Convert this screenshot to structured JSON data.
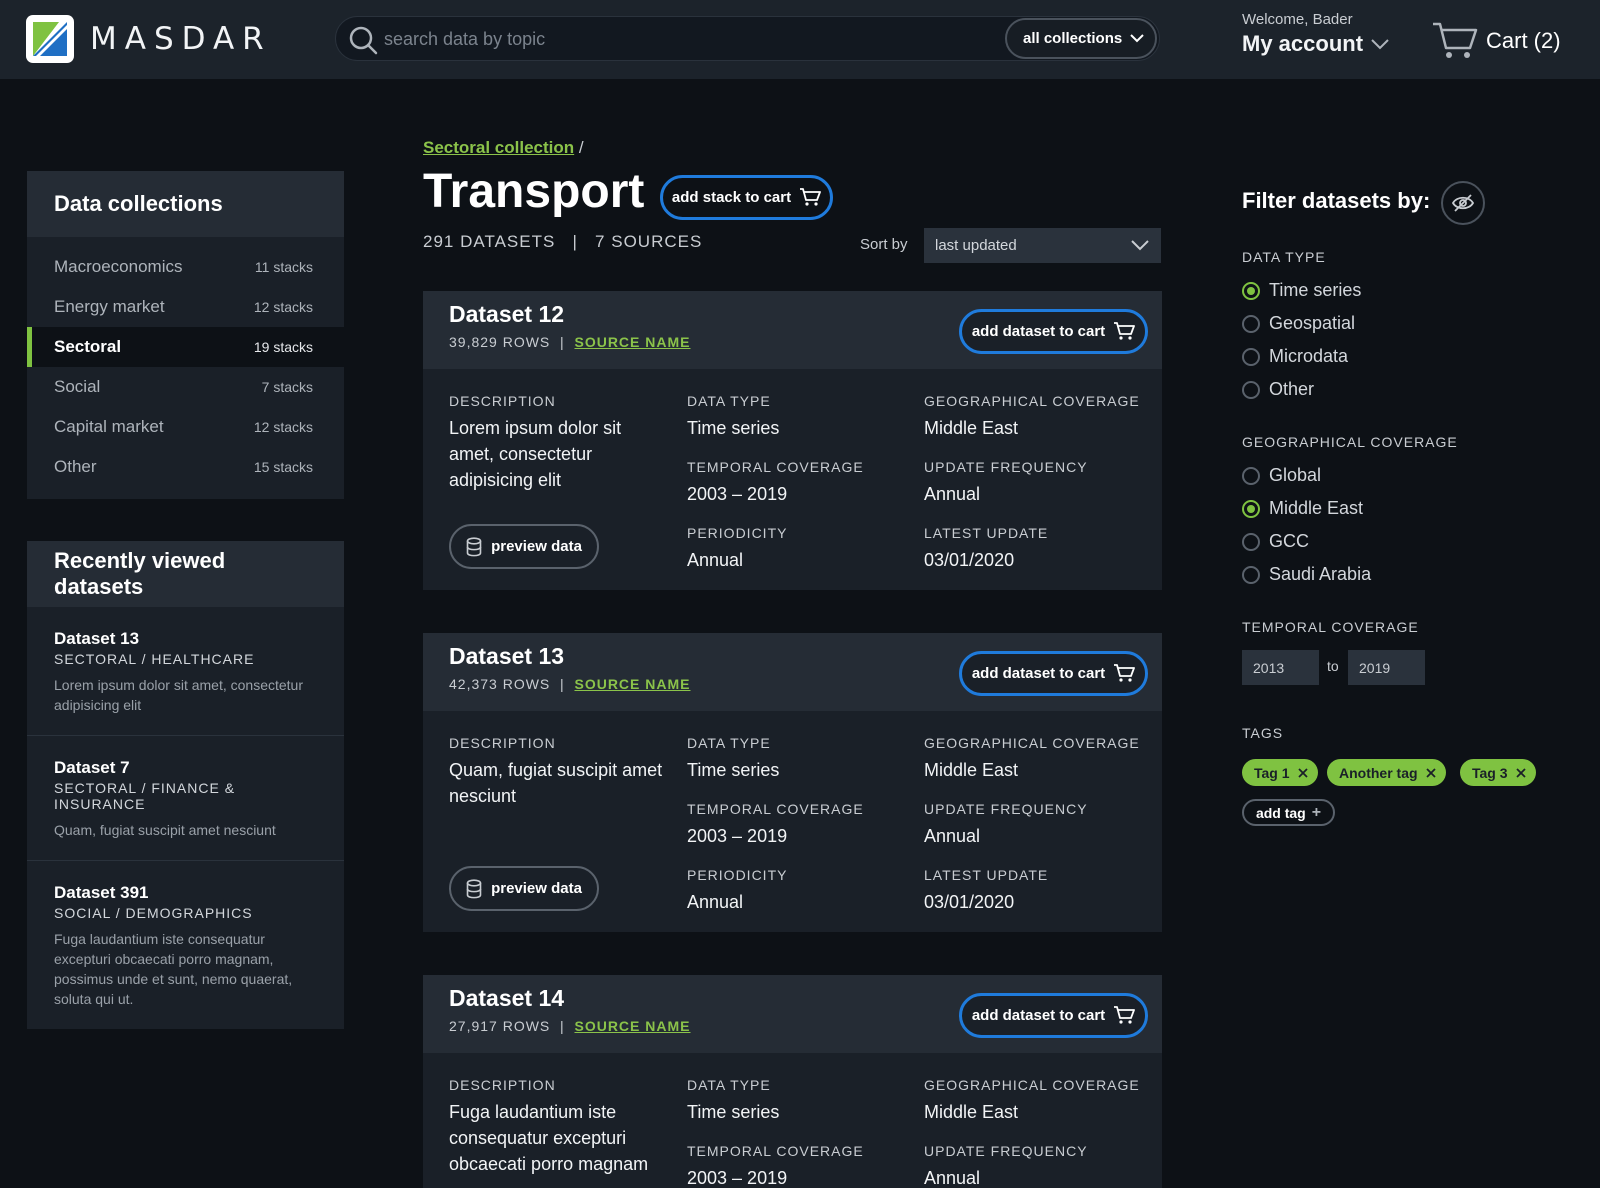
{
  "header": {
    "brand": "MASDAR",
    "search_placeholder": "search data by topic",
    "collection_select": "all collections",
    "welcome": "Welcome, Bader",
    "account": "My account",
    "cart": "Cart (2)"
  },
  "sidebar": {
    "collections_title": "Data collections",
    "collections": [
      {
        "label": "Macroeconomics",
        "count": "11 stacks"
      },
      {
        "label": "Energy market",
        "count": "12 stacks"
      },
      {
        "label": "Sectoral",
        "count": "19 stacks"
      },
      {
        "label": "Social",
        "count": "7 stacks"
      },
      {
        "label": "Capital market",
        "count": "12 stacks"
      },
      {
        "label": "Other",
        "count": "15 stacks"
      }
    ],
    "recent_title": "Recently viewed datasets",
    "recent": [
      {
        "title": "Dataset 13",
        "path": "SECTORAL / HEALTHCARE",
        "desc": "Lorem ipsum dolor sit amet, consectetur adipisicing elit"
      },
      {
        "title": "Dataset 7",
        "path": "SECTORAL / FINANCE & INSURANCE",
        "desc": "Quam, fugiat suscipit amet nesciunt"
      },
      {
        "title": "Dataset 391",
        "path": "SOCIAL / DEMOGRAPHICS",
        "desc": "Fuga laudantium iste consequatur excepturi obcaecati porro magnam, possimus unde et sunt, nemo quaerat, soluta qui ut."
      }
    ]
  },
  "main": {
    "breadcrumb_link": "Sectoral collection",
    "breadcrumb_sep": "/",
    "title": "Transport",
    "add_stack": "add stack to cart",
    "meta": "291 DATASETS   |   7 SOURCES",
    "sort_label": "Sort by",
    "sort_value": "last updated",
    "labels": {
      "description": "DESCRIPTION",
      "data_type": "DATA TYPE",
      "geo": "GEOGRAPHICAL COVERAGE",
      "temporal": "TEMPORAL COVERAGE",
      "update": "UPDATE FREQUENCY",
      "periodicity": "PERIODICITY",
      "latest": "LATEST UPDATE",
      "rows_suffix": "ROWS",
      "source": "SOURCE NAME",
      "add_dataset": "add dataset to cart",
      "preview": "preview data"
    },
    "datasets": [
      {
        "title": "Dataset 12",
        "rows": "39,829",
        "description": "Lorem ipsum dolor sit amet, consectetur adipisicing elit",
        "data_type": "Time series",
        "geo": "Middle East",
        "temporal": "2003 – 2019",
        "update": "Annual",
        "periodicity": "Annual",
        "latest": "03/01/2020"
      },
      {
        "title": "Dataset 13",
        "rows": "42,373",
        "description": "Quam, fugiat suscipit amet nesciunt",
        "data_type": "Time series",
        "geo": "Middle East",
        "temporal": "2003 – 2019",
        "update": "Annual",
        "periodicity": "Annual",
        "latest": "03/01/2020"
      },
      {
        "title": "Dataset 14",
        "rows": "27,917",
        "description": "Fuga laudantium iste consequatur excepturi obcaecati porro magnam",
        "data_type": "Time series",
        "geo": "Middle East",
        "temporal": "2003 – 2019",
        "update": "Annual",
        "periodicity": "",
        "latest": ""
      }
    ]
  },
  "filter": {
    "title": "Filter datasets by:",
    "data_type_label": "DATA TYPE",
    "data_types": [
      {
        "label": "Time series",
        "selected": true
      },
      {
        "label": "Geospatial",
        "selected": false
      },
      {
        "label": "Microdata",
        "selected": false
      },
      {
        "label": "Other",
        "selected": false
      }
    ],
    "geo_label": "GEOGRAPHICAL COVERAGE",
    "geos": [
      {
        "label": "Global",
        "selected": false
      },
      {
        "label": "Middle East",
        "selected": true
      },
      {
        "label": "GCC",
        "selected": false
      },
      {
        "label": "Saudi Arabia",
        "selected": false
      }
    ],
    "temporal_label": "TEMPORAL COVERAGE",
    "year_from": "2013",
    "year_to_label": "to",
    "year_to": "2019",
    "tags_label": "TAGS",
    "tags": [
      "Tag 1",
      "Another tag",
      "Tag 3"
    ],
    "add_tag": "add tag"
  },
  "colors": {
    "accent_green": "#7fc241",
    "accent_blue": "#1f7bdc",
    "background": "#0d1116"
  }
}
